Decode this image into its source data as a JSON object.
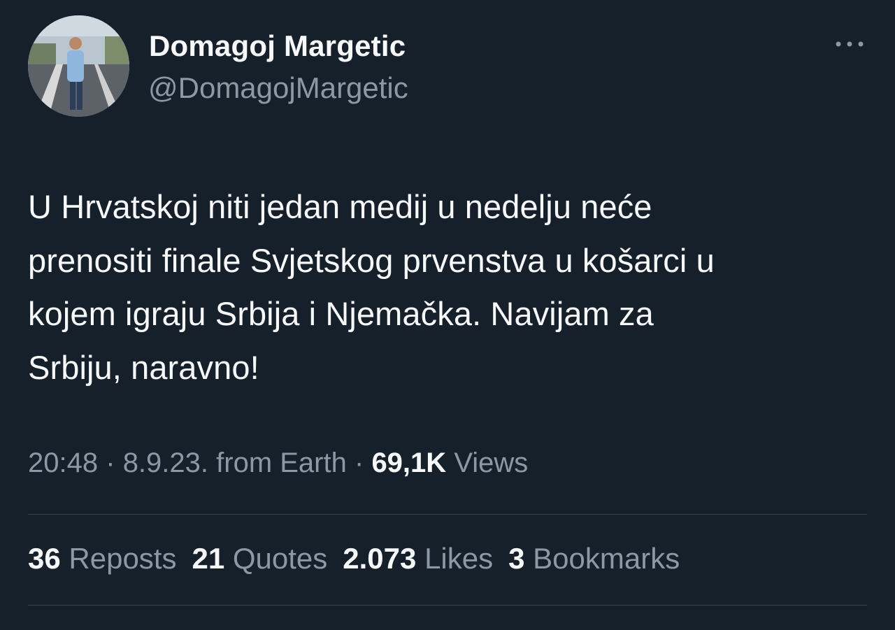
{
  "author": {
    "display_name": "Domagoj Margetic",
    "handle": "@DomagojMargetic"
  },
  "tweet": {
    "text": "U Hrvatskoj niti jedan medij u nedelju neće\nprenositi finale Svjetskog prvenstva u košarci u\nkojem igraju Srbija i Njemačka. Navijam za\nSrbiju, naravno!"
  },
  "meta": {
    "time": "20:48",
    "date": "8.9.23.",
    "source": "from Earth",
    "separator": "·",
    "views_count": "69,1K",
    "views_label": "Views"
  },
  "stats": {
    "reposts": {
      "count": "36",
      "label": "Reposts"
    },
    "quotes": {
      "count": "21",
      "label": "Quotes"
    },
    "likes": {
      "count": "2.073",
      "label": "Likes"
    },
    "bookmarks": {
      "count": "3",
      "label": "Bookmarks"
    }
  },
  "icons": {
    "more": "more-horizontal-icon"
  },
  "colors": {
    "background": "#15202b",
    "primary_text": "#f7f9f9",
    "secondary_text": "#8b98a5",
    "divider": "#38444d"
  }
}
